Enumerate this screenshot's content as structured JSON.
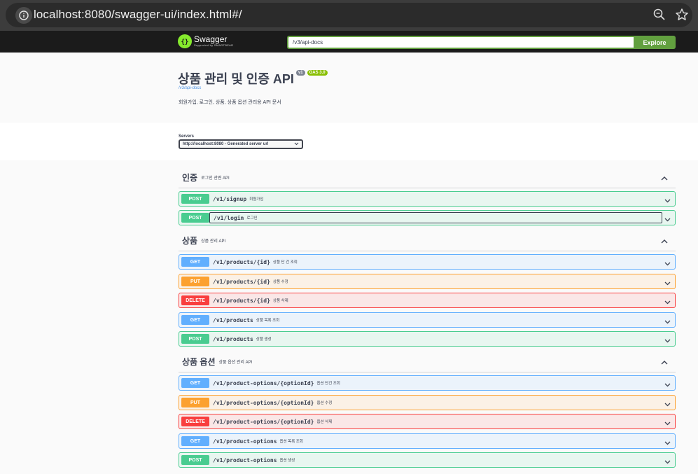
{
  "browser": {
    "url": "localhost:8080/swagger-ui/index.html#/"
  },
  "topbar": {
    "logo_name": "Swagger",
    "logo_sub": "Supported by SMARTBEAR",
    "spec_url": "/v3/api-docs",
    "explore_label": "Explore"
  },
  "info": {
    "title": "상품 관리 및 인증 API",
    "version": "v1",
    "oas": "OAS 3.0",
    "spec_link": "/v3/api-docs",
    "description": "회원가입, 로그인, 상품, 상품 옵션 관리용 API 문서"
  },
  "servers": {
    "label": "Servers",
    "selected": "http://localhost:8080 - Generated server url"
  },
  "tags": [
    {
      "name": "인증",
      "description": "로그인 관련 API",
      "operations": [
        {
          "method": "POST",
          "path": "/v1/signup",
          "summary": "회원가입"
        },
        {
          "method": "POST",
          "path": "/v1/login",
          "summary": "로그인"
        }
      ]
    },
    {
      "name": "상품",
      "description": "상품 관리 API",
      "operations": [
        {
          "method": "GET",
          "path": "/v1/products/{id}",
          "summary": "상품 단 건 조회"
        },
        {
          "method": "PUT",
          "path": "/v1/products/{id}",
          "summary": "상품 수정"
        },
        {
          "method": "DELETE",
          "path": "/v1/products/{id}",
          "summary": "상품 삭제"
        },
        {
          "method": "GET",
          "path": "/v1/products",
          "summary": "상품 목록 조회"
        },
        {
          "method": "POST",
          "path": "/v1/products",
          "summary": "상품 생성"
        }
      ]
    },
    {
      "name": "상품 옵션",
      "description": "상품 옵션 관리 API",
      "operations": [
        {
          "method": "GET",
          "path": "/v1/product-options/{optionId}",
          "summary": "옵션 단건 조회"
        },
        {
          "method": "PUT",
          "path": "/v1/product-options/{optionId}",
          "summary": "옵션 수정"
        },
        {
          "method": "DELETE",
          "path": "/v1/product-options/{optionId}",
          "summary": "옵션 삭제"
        },
        {
          "method": "GET",
          "path": "/v1/product-options",
          "summary": "옵션 목록 조회"
        },
        {
          "method": "POST",
          "path": "/v1/product-options",
          "summary": "옵션 생성"
        }
      ]
    }
  ],
  "colors": {
    "post": "#49cc90",
    "get": "#61affe",
    "put": "#fca130",
    "delete": "#f93e3e",
    "explore": "#62a03f"
  }
}
